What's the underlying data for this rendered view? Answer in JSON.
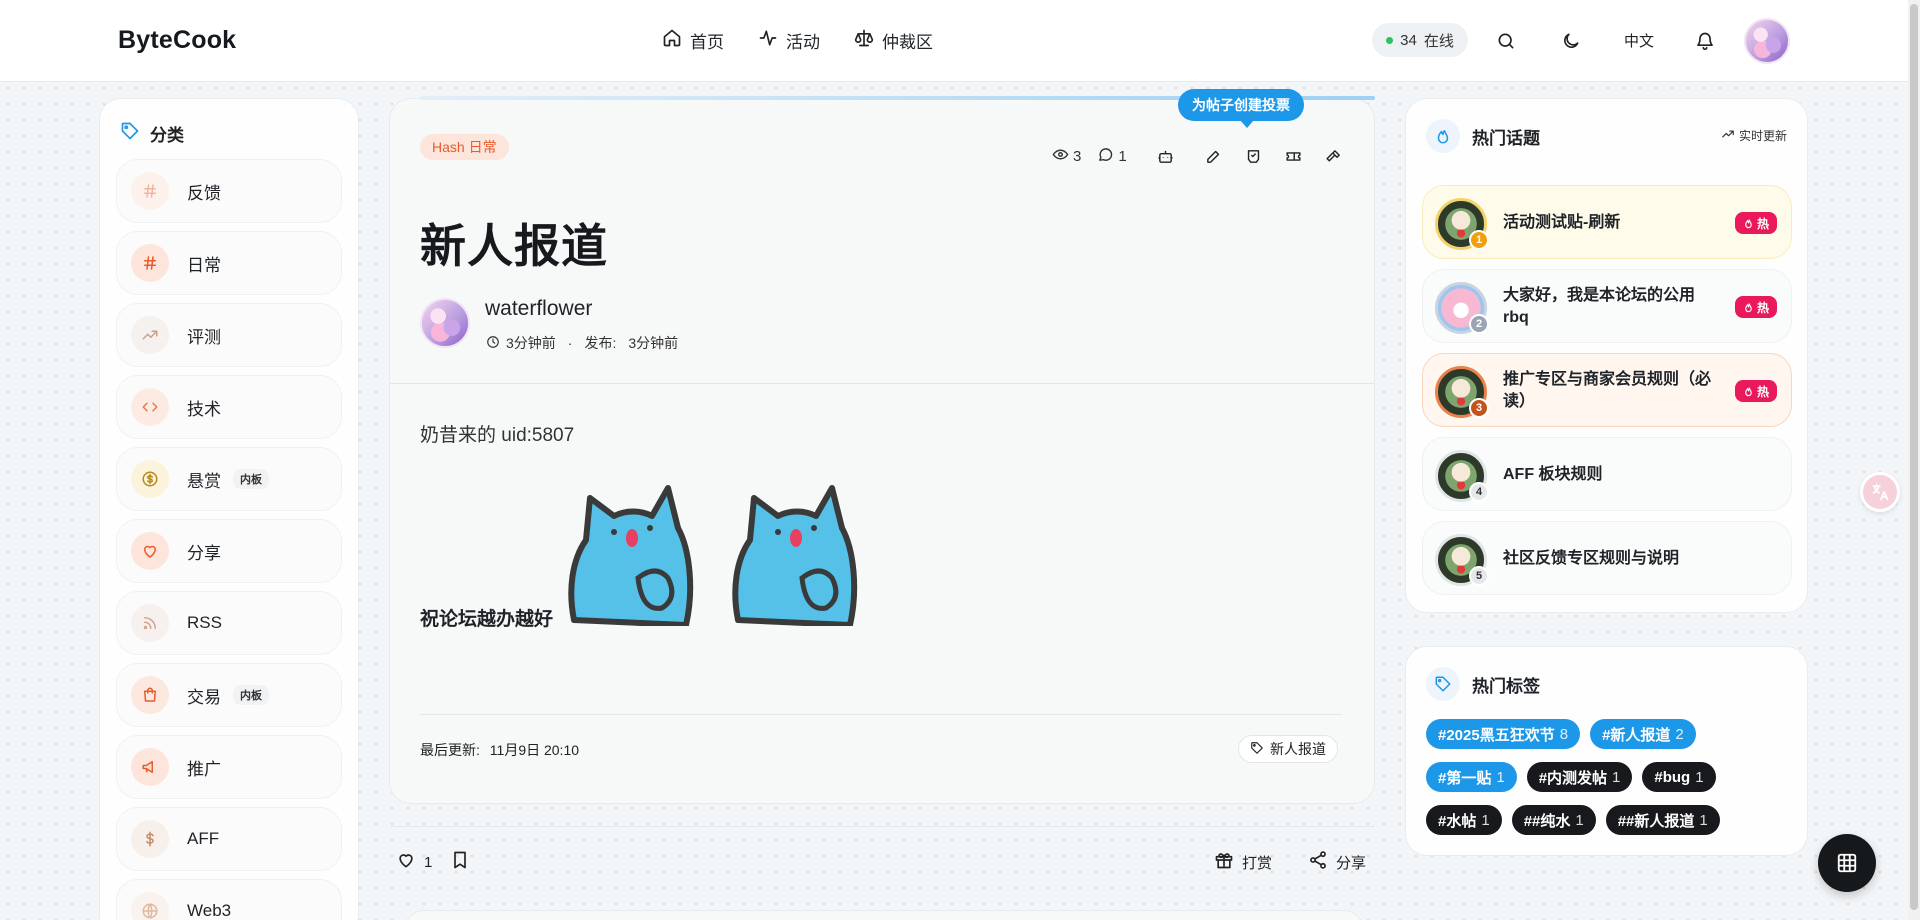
{
  "header": {
    "brand": "ByteCook",
    "nav": [
      {
        "label": "首页",
        "icon": "home-icon"
      },
      {
        "label": "活动",
        "icon": "activity-icon"
      },
      {
        "label": "仲裁区",
        "icon": "scale-icon"
      }
    ],
    "online_count": "34",
    "online_label": "在线",
    "language": "中文"
  },
  "sidebar": {
    "heading": "分类",
    "items": [
      {
        "label": "反馈",
        "icon": "hash-icon",
        "badge": ""
      },
      {
        "label": "日常",
        "icon": "hash-icon",
        "badge": ""
      },
      {
        "label": "评测",
        "icon": "trending-icon",
        "badge": ""
      },
      {
        "label": "技术",
        "icon": "code-icon",
        "badge": ""
      },
      {
        "label": "悬赏",
        "icon": "coin-icon",
        "badge": "内板"
      },
      {
        "label": "分享",
        "icon": "heart-icon",
        "badge": ""
      },
      {
        "label": "RSS",
        "icon": "rss-icon",
        "badge": ""
      },
      {
        "label": "交易",
        "icon": "bag-icon",
        "badge": "内板"
      },
      {
        "label": "推广",
        "icon": "megaphone-icon",
        "badge": ""
      },
      {
        "label": "AFF",
        "icon": "dollar-icon",
        "badge": ""
      },
      {
        "label": "Web3",
        "icon": "globe-icon",
        "badge": ""
      }
    ]
  },
  "post": {
    "category_tag": "Hash 日常",
    "views": "3",
    "comments": "1",
    "tooltip": "为帖子创建投票",
    "title": "新人报道",
    "author": "waterflower",
    "time_ago": "3分钟前",
    "published_label": "发布:",
    "published_ago": "3分钟前",
    "body_line1": "奶昔来的 uid:5807",
    "body_line2": "祝论坛越办越好",
    "last_update_label": "最后更新:",
    "last_update": "11月9日 20:10",
    "tag": "新人报道",
    "likes": "1",
    "tip_label": "打赏",
    "share_label": "分享"
  },
  "hot_topics": {
    "heading": "热门话题",
    "realtime_label": "实时更新",
    "hot_label": "热",
    "items": [
      {
        "rank": "1",
        "title": "活动测试贴-刷新",
        "hot": true,
        "rank_color": "#f59e0b"
      },
      {
        "rank": "2",
        "title": "大家好，我是本论坛的公用rbq",
        "hot": true,
        "rank_color": "#9aa4b2"
      },
      {
        "rank": "3",
        "title": "推广专区与商家会员规则（必读）",
        "hot": true,
        "rank_color": "#c2531b"
      },
      {
        "rank": "4",
        "title": "AFF 板块规则",
        "hot": false,
        "rank_color": "#e5e7eb"
      },
      {
        "rank": "5",
        "title": "社区反馈专区规则与说明",
        "hot": false,
        "rank_color": "#e5e7eb"
      }
    ]
  },
  "hot_tags": {
    "heading": "热门标签",
    "items": [
      {
        "label": "#2025黑五狂欢节",
        "count": "8",
        "style": "blue"
      },
      {
        "label": "#新人报道",
        "count": "2",
        "style": "blue"
      },
      {
        "label": "#第一贴",
        "count": "1",
        "style": "blue"
      },
      {
        "label": "#内测发帖",
        "count": "1",
        "style": "dark"
      },
      {
        "label": "#bug",
        "count": "1",
        "style": "dark"
      },
      {
        "label": "#水帖",
        "count": "1",
        "style": "dark"
      },
      {
        "label": "##纯水",
        "count": "1",
        "style": "dark"
      },
      {
        "label": "##新人报道",
        "count": "1",
        "style": "dark"
      }
    ]
  },
  "colors": {
    "accent_blue": "#1d97e8",
    "hot_pink": "#e9195c",
    "category_orange": "#ea5a2b"
  }
}
